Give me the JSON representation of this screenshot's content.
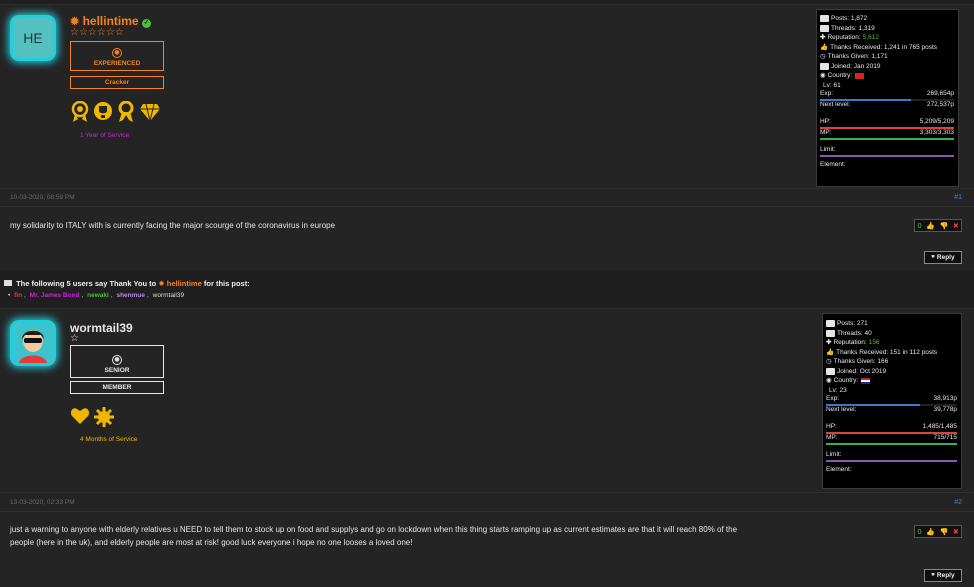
{
  "colors": {
    "accent_orange": "#f5821f",
    "purple": "#c22ad1",
    "green": "#4fbf3b",
    "link_blue": "#3d7fd6",
    "gold": "#f0b700",
    "exp_bar": "#3a78d6",
    "hp_bar": "#e04040",
    "mp_bar": "#36b050",
    "limit_bar": "#8d55b8"
  },
  "posts": [
    {
      "avatar_text": "HE",
      "username": "hellintime",
      "stars": "☆☆☆☆☆☆",
      "rank": "EXPERIENCED",
      "group": "Cracker",
      "service": "1 Year of Service",
      "stats": {
        "posts": "Posts: 1,872",
        "threads": "Threads: 1,319",
        "reputation_label": "Reputation: ",
        "reputation_value": "5,612",
        "thanks_received": "Thanks Received: 1,241 in 765 posts",
        "thanks_given": "Thanks Given: 1,171",
        "joined": "Joined: Jan 2019",
        "country": "Country:",
        "lv": "Lv: 61",
        "exp_label": "Exp:",
        "exp_value": "269,654p",
        "exp_fill": 0.68,
        "next_label": "Next level:",
        "next_value": "272,537p",
        "hp_label": "HP:",
        "hp_value": "5,209/5,209",
        "hp_fill": 1.0,
        "mp_label": "MP:",
        "mp_value": "3,303/3,303",
        "mp_fill": 1.0,
        "limit_label": "Limit:",
        "element_label": "Element:"
      },
      "date": "10-03-2020, 08:59 PM",
      "number": "#1",
      "message": "my solidarity to ITALY with is  currently  facing the major scourge of the coronavirus  in europe",
      "rating_count": "0",
      "reply_label": "Reply"
    },
    {
      "username": "wormtail39",
      "stars": "☆",
      "rank": "SENIOR",
      "group": "MEMBER",
      "service": "4 Months of Service",
      "stats": {
        "posts": "Posts: 271",
        "threads": "Threads: 40",
        "reputation_label": "Reputation: ",
        "reputation_value": "156",
        "thanks_received": "Thanks Received: 151 in 112 posts",
        "thanks_given": "Thanks Given: 166",
        "joined": "Joined: Oct 2019",
        "country": "Country:",
        "lv": "Lv: 23",
        "exp_label": "Exp:",
        "exp_value": "38,913p",
        "exp_fill": 0.72,
        "next_label": "Next level:",
        "next_value": "39,778p",
        "hp_label": "HP:",
        "hp_value": "1,485/1,485",
        "hp_fill": 1.0,
        "mp_label": "MP:",
        "mp_value": "715/715",
        "mp_fill": 1.0,
        "limit_label": "Limit:",
        "element_label": "Element:"
      },
      "date": "13-03-2020, 02:33 PM",
      "number": "#2",
      "message_line1": "just a warning to anyone with elderly relatives u NEED to tell them to stock up on food and supplys and go on lockdown when this thing starts ramping up as current estimates are that it will reach 80% of the",
      "message_line2": "people (here in the uk), and elderly people are most at risk! good luck everyone i hope no one looses a loved one!",
      "rating_count": "0",
      "reply_label": "Reply"
    }
  ],
  "thanks": {
    "prefix": "The following 5 users say Thank You to",
    "user": "hellintime",
    "suffix": "for this post:",
    "users": [
      "fin",
      "Mr. James Bond",
      "newaki",
      "shenmue",
      "wormtail39"
    ]
  }
}
